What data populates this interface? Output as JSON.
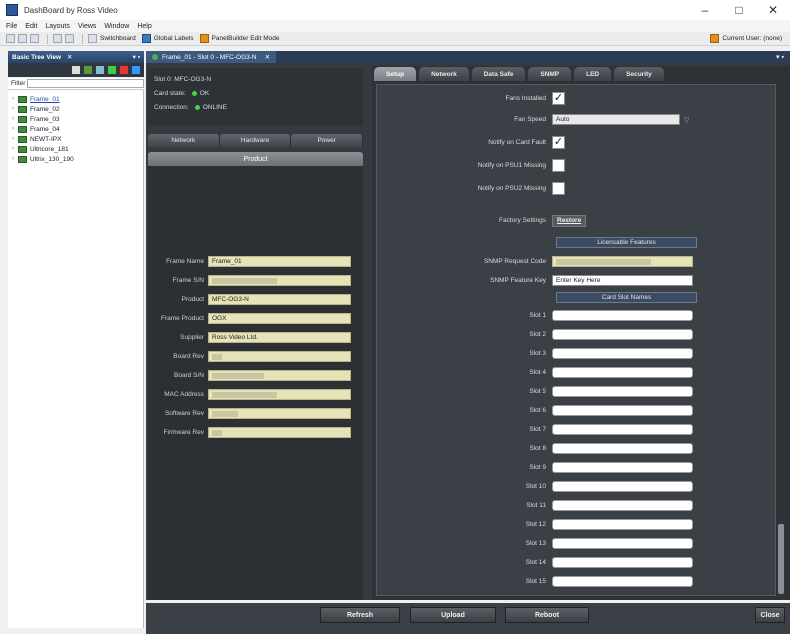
{
  "window": {
    "title": "DashBoard by Ross Video",
    "min": "–",
    "max": "□",
    "close": "✕"
  },
  "menu": [
    "File",
    "Edit",
    "Layouts",
    "Views",
    "Window",
    "Help"
  ],
  "toolbar": {
    "switchboard": "Switchboard",
    "global_labels": "Global Labels",
    "panelbuilder": "PanelBuilder Edit Mode",
    "current_user": "Current User: (none)"
  },
  "tree": {
    "header": "Basic Tree View",
    "close": "✕",
    "filter_label": "Filter",
    "nodes": [
      {
        "label": "Frame_01"
      },
      {
        "label": "Frame_02"
      },
      {
        "label": "Frame_03"
      },
      {
        "label": "Frame_04"
      },
      {
        "label": "NEWT-IPX"
      },
      {
        "label": "Ultricore_181"
      },
      {
        "label": "Ultrix_130_190"
      }
    ]
  },
  "main_tab": {
    "label": "Frame_01 - Slot 0 - MFC-OG3-N",
    "close": "✕"
  },
  "status": {
    "slot": "Slot 0: MFC-OG3-N",
    "card_state_label": "Card state:",
    "card_state_value": "OK",
    "connection_label": "Connection:",
    "connection_value": "ONLINE"
  },
  "left_tabs": [
    "Network",
    "Hardware",
    "Power"
  ],
  "product_tab": "Product",
  "product_fields": [
    {
      "label": "Frame Name",
      "value": "Frame_01"
    },
    {
      "label": "Frame S/N",
      "value": ""
    },
    {
      "label": "Product",
      "value": "MFC-OG3-N"
    },
    {
      "label": "Frame Product",
      "value": "OGX"
    },
    {
      "label": "Supplier",
      "value": "Ross Video Ltd."
    },
    {
      "label": "Board Rev",
      "value": ""
    },
    {
      "label": "Board S/N",
      "value": ""
    },
    {
      "label": "MAC Address",
      "value": ""
    },
    {
      "label": "Software Rev",
      "value": ""
    },
    {
      "label": "Firmware Rev",
      "value": ""
    }
  ],
  "right_tabs": [
    "Setup",
    "Network",
    "Data Safe",
    "SNMP",
    "LED",
    "Security"
  ],
  "setup": {
    "fans_installed": "Fans Installed",
    "fan_speed": "Fan Speed",
    "fan_speed_value": "Auto",
    "notify_card_fault": "Notify on Card Fault",
    "notify_psu1": "Notify on PSU1 Missing",
    "notify_psu2": "Notify on PSU2 Missing",
    "factory_settings": "Factory Settings",
    "restore": "Restore",
    "licensable_features": "Licensable Features",
    "snmp_request_code": "SNMP Request Code",
    "snmp_feature_key": "SNMP Feature Key",
    "snmp_feature_key_value": "Enter Key Here",
    "card_slot_names": "Card Slot Names",
    "checkmark": "✓"
  },
  "slots": [
    "Slot 1",
    "Slot 2",
    "Slot 3",
    "Slot 4",
    "Slot 5",
    "Slot 6",
    "Slot 7",
    "Slot 8",
    "Slot 9",
    "Slot 10",
    "Slot 11",
    "Slot 12",
    "Slot 13",
    "Slot 14",
    "Slot 15"
  ],
  "bottom": {
    "refresh": "Refresh",
    "upload": "Upload",
    "reboot": "Reboot",
    "close": "Close"
  }
}
